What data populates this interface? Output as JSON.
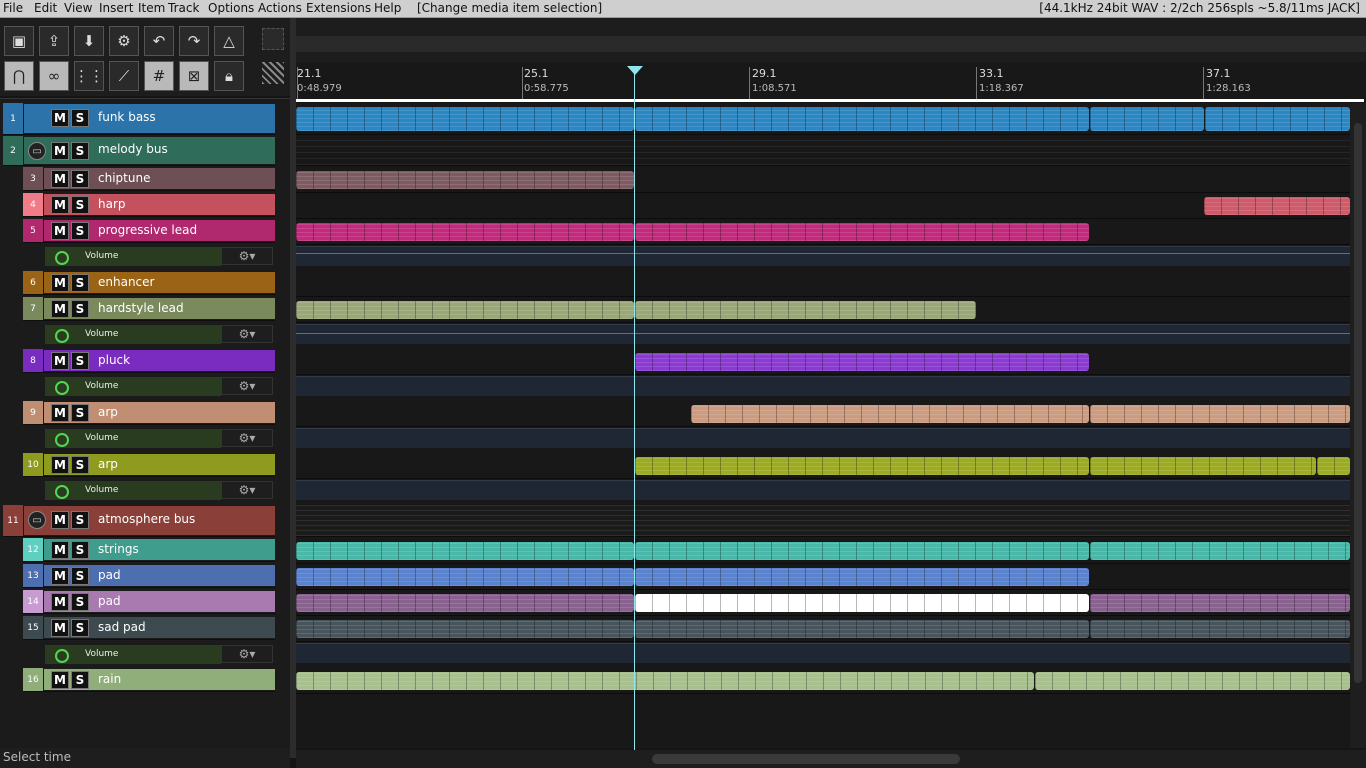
{
  "menu": {
    "items": [
      "File",
      "Edit",
      "View",
      "Insert",
      "Item",
      "Track",
      "Options",
      "Actions",
      "Extensions",
      "Help"
    ],
    "action_status": "[Change media item selection]",
    "audio_info": "[44.1kHz 24bit WAV : 2/2ch 256spls ~5.8/11ms JACK]"
  },
  "toolbar": {
    "icons": [
      "project-icon",
      "render-icon",
      "save-icon",
      "settings-icon",
      "undo-icon",
      "redo-icon",
      "metronome-icon",
      "crossfade-icon",
      "link-icon",
      "grid-icon",
      "envelope-link-icon",
      "snap-grid-icon",
      "ripple-icon",
      "lock-icon"
    ]
  },
  "ruler": {
    "markers": [
      {
        "bar": "21.1",
        "time": "0:48.979"
      },
      {
        "bar": "25.1",
        "time": "0:58.775"
      },
      {
        "bar": "29.1",
        "time": "1:08.571"
      },
      {
        "bar": "33.1",
        "time": "1:18.367"
      },
      {
        "bar": "37.1",
        "time": "1:28.163"
      }
    ]
  },
  "buttons": {
    "mute": "M",
    "solo": "S"
  },
  "tracks": [
    {
      "num": "1",
      "name": "funk bass",
      "color": "#2b73a8"
    },
    {
      "num": "2",
      "name": "melody bus",
      "color": "#2f6c5a",
      "folder": true
    },
    {
      "num": "3",
      "name": "chiptune",
      "color": "#6e4f55"
    },
    {
      "num": "4",
      "name": "harp",
      "color": "#c4525e"
    },
    {
      "num": "5",
      "name": "progressive lead",
      "color": "#b0286e",
      "envelope": "Volume"
    },
    {
      "num": "6",
      "name": "enhancer",
      "color": "#9a6315"
    },
    {
      "num": "7",
      "name": "hardstyle lead",
      "color": "#7b8a5c",
      "envelope": "Volume"
    },
    {
      "num": "8",
      "name": "pluck",
      "color": "#7a2bc0",
      "envelope": "Volume"
    },
    {
      "num": "9",
      "name": "arp",
      "color": "#c08e72",
      "envelope": "Volume"
    },
    {
      "num": "10",
      "name": "arp",
      "color": "#8e9b1e",
      "envelope": "Volume"
    },
    {
      "num": "11",
      "name": "atmosphere bus",
      "color": "#8a4038",
      "folder": true
    },
    {
      "num": "12",
      "name": "strings",
      "color": "#3f9d8e"
    },
    {
      "num": "13",
      "name": "pad",
      "color": "#4d6fb0"
    },
    {
      "num": "14",
      "name": "pad",
      "color": "#a87ab0"
    },
    {
      "num": "15",
      "name": "sad pad",
      "color": "#3d4a50",
      "envelope": "Volume"
    },
    {
      "num": "16",
      "name": "rain",
      "color": "#8fae79"
    }
  ],
  "status_bar": "Select time"
}
